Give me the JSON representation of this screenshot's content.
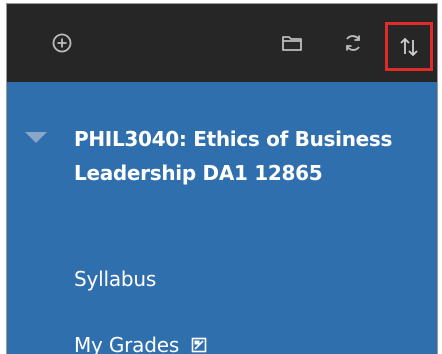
{
  "toolbar": {
    "buttons": [
      {
        "icon": "plus-circle-icon"
      },
      {
        "icon": "folder-icon"
      },
      {
        "icon": "refresh-icon"
      },
      {
        "icon": "sort-arrows-icon",
        "highlighted": true
      }
    ],
    "background": "#262626",
    "highlight_color": "#e02b2b"
  },
  "course": {
    "title": "PHIL3040: Ethics of Business Leadership DA1 12865",
    "expanded": true
  },
  "menu": {
    "background": "#2f6fae",
    "items": [
      {
        "label": "Syllabus"
      },
      {
        "label": "My Grades",
        "icon": "external-link-icon"
      }
    ]
  }
}
